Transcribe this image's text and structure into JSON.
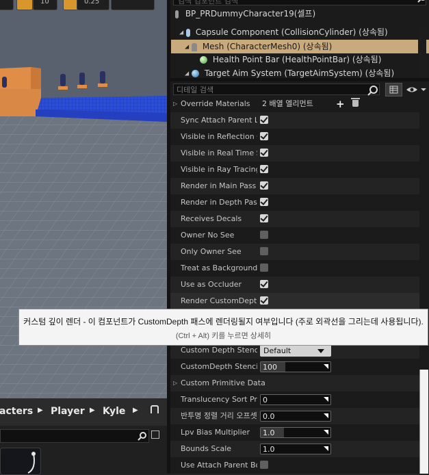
{
  "viewport": {
    "toolbar": {
      "value_a": "10",
      "value_b": "0.25"
    }
  },
  "content_browser": {
    "breadcrumbs": [
      "acters",
      "Player",
      "Kyle"
    ]
  },
  "components": {
    "search_placeholder": "검색 컴포넌트 검색",
    "items": [
      {
        "label": "BP_PRDummyCharacter19(셀프)",
        "icon": "character-icon"
      },
      {
        "label": "Capsule Component (CollisionCylinder) (상속됨)",
        "icon": "capsule-icon"
      },
      {
        "label": "Mesh (CharacterMesh0) (상속됨)",
        "icon": "mesh-icon",
        "selected": true
      },
      {
        "label": "Health Point Bar (HealthPointBar) (상속됨)",
        "icon": "widget-icon"
      },
      {
        "label": "Target Aim System (TargetAimSystem) (상속됨)",
        "icon": "scene-icon"
      }
    ]
  },
  "details": {
    "search_placeholder": "디테일 검색",
    "properties": [
      {
        "name": "Override Materials",
        "kind": "array",
        "value": "2 배열 엘리먼트"
      },
      {
        "name": "Sync Attach Parent LOD",
        "kind": "check",
        "checked": true
      },
      {
        "name": "Visible in Reflection Captures",
        "kind": "check",
        "checked": true
      },
      {
        "name": "Visible in Real Time Sky Captures",
        "kind": "check",
        "checked": true
      },
      {
        "name": "Visible in Ray Tracing",
        "kind": "check",
        "checked": true
      },
      {
        "name": "Render in Main Pass",
        "kind": "check",
        "checked": true
      },
      {
        "name": "Render in Depth Pass",
        "kind": "check",
        "checked": true
      },
      {
        "name": "Receives Decals",
        "kind": "check",
        "checked": true
      },
      {
        "name": "Owner No See",
        "kind": "check",
        "checked": false
      },
      {
        "name": "Only Owner See",
        "kind": "check",
        "checked": false
      },
      {
        "name": "Treat as Background for Occlusion",
        "kind": "check",
        "checked": false
      },
      {
        "name": "Use as Occluder",
        "kind": "check",
        "checked": true
      },
      {
        "name": "Render CustomDepth Pass",
        "kind": "check",
        "checked": true
      },
      {
        "name": "",
        "kind": "hidden"
      },
      {
        "name": "",
        "kind": "hidden"
      },
      {
        "name": "Custom Depth Stencil Write Mask",
        "kind": "combo",
        "value": "Default"
      },
      {
        "name": "CustomDepth Stencil Value",
        "kind": "slider",
        "value": "100",
        "fill": 0.35
      },
      {
        "name": "Custom Primitive Data",
        "kind": "group"
      },
      {
        "name": "Translucency Sort Priority",
        "kind": "number",
        "value": "0"
      },
      {
        "name": "반투명 정렬 거리 오프셋",
        "kind": "number",
        "value": "0.0"
      },
      {
        "name": "Lpv Bias Multiplier",
        "kind": "slider",
        "value": "1.0",
        "fill": 0.33
      },
      {
        "name": "Bounds Scale",
        "kind": "number",
        "value": "1.0"
      },
      {
        "name": "Use Attach Parent Bound",
        "kind": "check",
        "checked": false
      }
    ]
  },
  "tooltip": {
    "text": "커스텀 깊이 렌더 - 이 컴포넌트가 CustomDepth 패스에 렌더링될지 여부입니다 (주로 외곽선을 그리는데 사용됩니다).",
    "hint": "(Ctrl + Alt) 키를 누르면 상세히"
  }
}
